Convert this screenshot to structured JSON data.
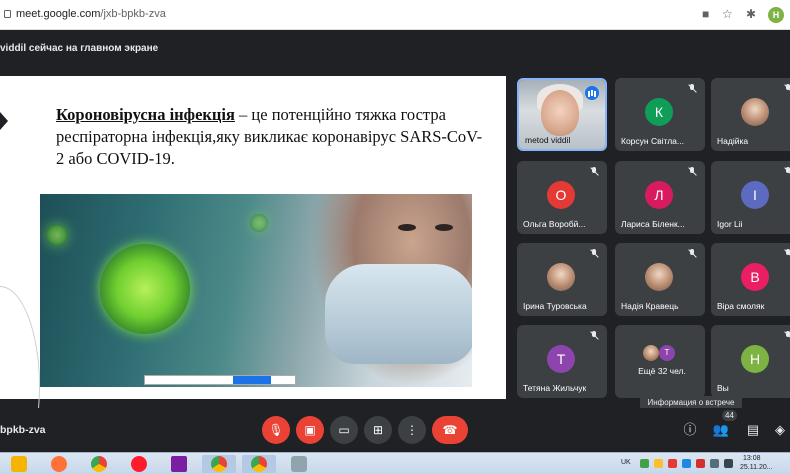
{
  "browser": {
    "url_host": "meet.google.com",
    "url_path": "/jxb-bpkb-zva",
    "profile_initial": "Н",
    "icons": [
      "lock-icon",
      "camera-blocked-icon",
      "bookmark-star-icon",
      "extension-icon"
    ]
  },
  "banner": {
    "text": "viddil сейчас на главном экране"
  },
  "slide": {
    "title_bold": "Короновірусна інфекція",
    "text_rest": " – це потенційно тяжка гостра респіраторна інфекція,яку викликає коронавірус SARS-CoV-2 або COVID-19."
  },
  "participants": [
    {
      "name": "metod viddil",
      "type": "video",
      "speaking": true
    },
    {
      "name": "Корсун Світла...",
      "initial": "К",
      "color": "#0f9d58",
      "muted": true
    },
    {
      "name": "Надійка",
      "type": "photo",
      "muted": true
    },
    {
      "name": "Ольга Воробй...",
      "initial": "О",
      "color": "#e53935",
      "muted": true
    },
    {
      "name": "Лариса Біленк...",
      "initial": "Л",
      "color": "#d81b60",
      "muted": true
    },
    {
      "name": "Igor Lii",
      "initial": "I",
      "color": "#5c6bc0",
      "muted": true
    },
    {
      "name": "Ірина Туровська",
      "type": "photo",
      "muted": true
    },
    {
      "name": "Надія Кравець",
      "type": "photo",
      "muted": true
    },
    {
      "name": "Віра смоляк",
      "initial": "В",
      "color": "#e91e63",
      "muted": true
    },
    {
      "name": "Тетяна Жильчук",
      "initial": "Т",
      "color": "#8e44ad",
      "muted": true
    },
    {
      "name": "Ещё 32 чел.",
      "type": "more",
      "mini_initial": "Т"
    },
    {
      "name": "Вы",
      "initial": "Н",
      "color": "#7cb342",
      "muted": true
    }
  ],
  "tooltip": "Информация о встрече",
  "controls": {
    "meet_code": "bpkb-zva",
    "participant_count": "44",
    "buttons": [
      "mic-off-icon",
      "camera-off-icon",
      "captions-icon",
      "present-icon",
      "more-icon",
      "hangup-icon"
    ],
    "right_icons": [
      "info-icon",
      "people-icon",
      "chat-icon",
      "activities-icon"
    ]
  },
  "taskbar": {
    "lang": "UK",
    "time": "13:08",
    "date": "25.11.20..."
  }
}
